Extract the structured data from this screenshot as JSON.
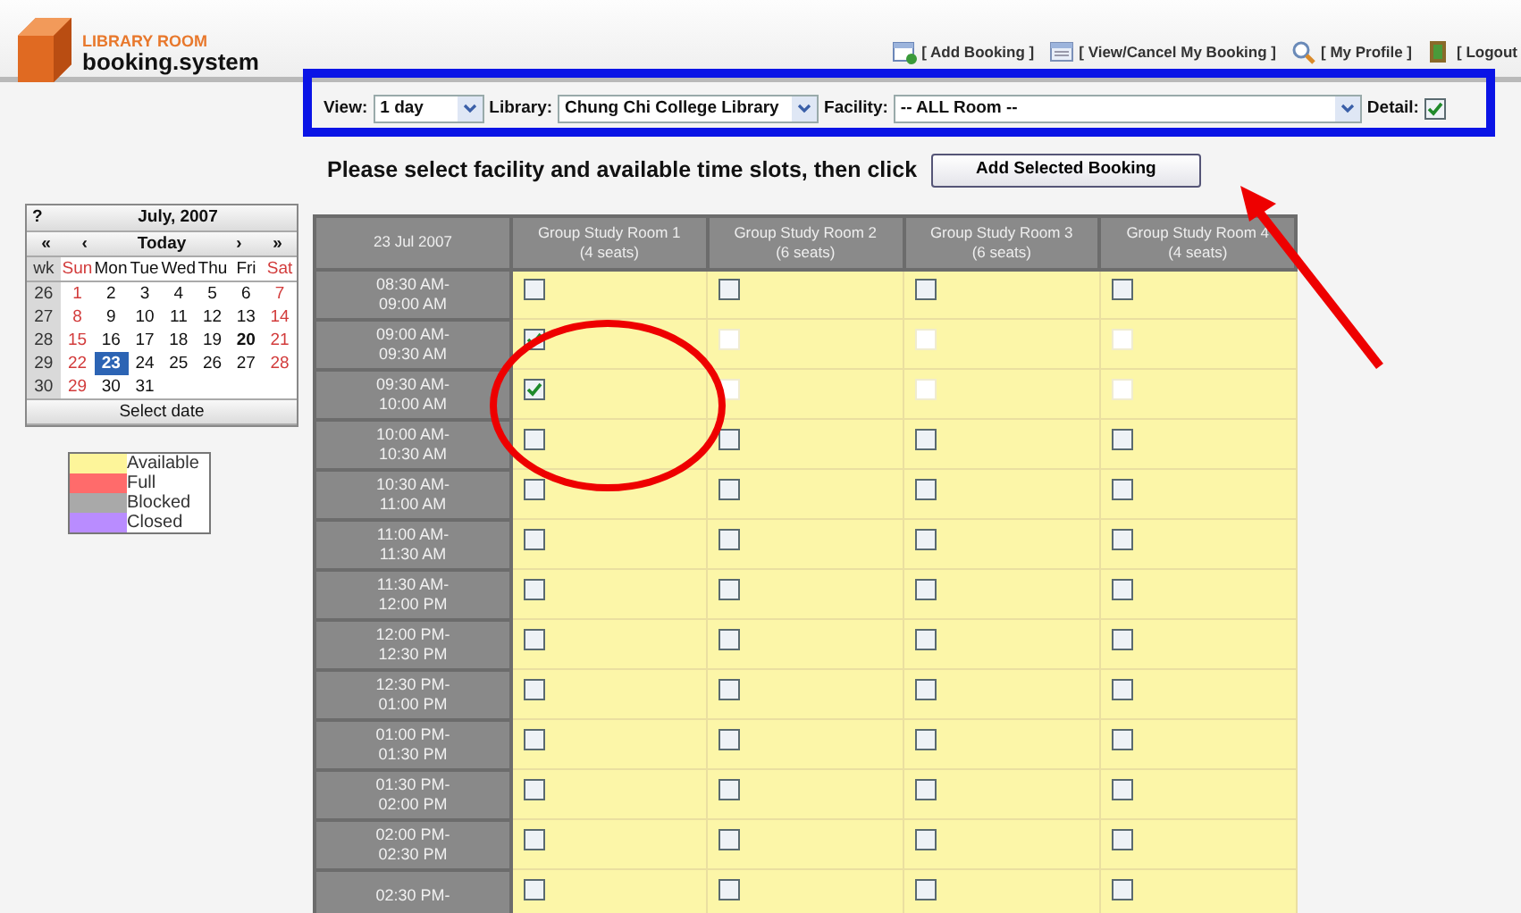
{
  "logo": {
    "line_1": "LIBRARY ROOM",
    "line_2": "booking.system"
  },
  "nav_links": [
    {
      "kind": "add",
      "label": "[ Add Booking ]"
    },
    {
      "kind": "list",
      "label": "[ View/Cancel My Booking ]"
    },
    {
      "kind": "search",
      "label": "[ My Profile ]"
    },
    {
      "kind": "exit",
      "label": "[ Logout"
    }
  ],
  "filters": {
    "view_label": "View:",
    "view_value": "1 day",
    "library_label": "Library:",
    "library_value": "Chung Chi College Library",
    "facility_label": "Facility:",
    "facility_value": "-- ALL Room --",
    "detail_label": "Detail:",
    "detail_checked": true
  },
  "instruction": "Please select facility and available time slots, then click",
  "add_button": "Add Selected Booking",
  "calendar": {
    "help": "?",
    "title": "July, 2007",
    "nav": [
      "«",
      "‹",
      "Today",
      "›",
      "»"
    ],
    "weekdays": [
      {
        "label": "wk",
        "weekend": false
      },
      {
        "label": "Sun",
        "weekend": true
      },
      {
        "label": "Mon",
        "weekend": false
      },
      {
        "label": "Tue",
        "weekend": false
      },
      {
        "label": "Wed",
        "weekend": false
      },
      {
        "label": "Thu",
        "weekend": false
      },
      {
        "label": "Fri",
        "weekend": false
      },
      {
        "label": "Sat",
        "weekend": true
      }
    ],
    "weeks": [
      {
        "week": "26",
        "days": [
          {
            "text": "1",
            "selected": false,
            "today": false
          },
          {
            "text": "2",
            "selected": false,
            "today": false
          },
          {
            "text": "3",
            "selected": false,
            "today": false
          },
          {
            "text": "4",
            "selected": false,
            "today": false
          },
          {
            "text": "5",
            "selected": false,
            "today": false
          },
          {
            "text": "6",
            "selected": false,
            "today": false
          },
          {
            "text": "7",
            "selected": false,
            "today": false
          }
        ]
      },
      {
        "week": "27",
        "days": [
          {
            "text": "8",
            "selected": false,
            "today": false
          },
          {
            "text": "9",
            "selected": false,
            "today": false
          },
          {
            "text": "10",
            "selected": false,
            "today": false
          },
          {
            "text": "11",
            "selected": false,
            "today": false
          },
          {
            "text": "12",
            "selected": false,
            "today": false
          },
          {
            "text": "13",
            "selected": false,
            "today": false
          },
          {
            "text": "14",
            "selected": false,
            "today": false
          }
        ]
      },
      {
        "week": "28",
        "days": [
          {
            "text": "15",
            "selected": false,
            "today": false
          },
          {
            "text": "16",
            "selected": false,
            "today": false
          },
          {
            "text": "17",
            "selected": false,
            "today": false
          },
          {
            "text": "18",
            "selected": false,
            "today": false
          },
          {
            "text": "19",
            "selected": false,
            "today": false
          },
          {
            "text": "20",
            "selected": false,
            "today": true
          },
          {
            "text": "21",
            "selected": false,
            "today": false
          }
        ]
      },
      {
        "week": "29",
        "days": [
          {
            "text": "22",
            "selected": false,
            "today": false
          },
          {
            "text": "23",
            "selected": true,
            "today": false
          },
          {
            "text": "24",
            "selected": false,
            "today": false
          },
          {
            "text": "25",
            "selected": false,
            "today": false
          },
          {
            "text": "26",
            "selected": false,
            "today": false
          },
          {
            "text": "27",
            "selected": false,
            "today": false
          },
          {
            "text": "28",
            "selected": false,
            "today": false
          }
        ]
      },
      {
        "week": "30",
        "days": [
          {
            "text": "29",
            "selected": false,
            "today": false
          },
          {
            "text": "30",
            "selected": false,
            "today": false
          },
          {
            "text": "31",
            "selected": false,
            "today": false
          }
        ]
      }
    ],
    "footer": "Select date"
  },
  "legend": [
    {
      "label": "Available",
      "color": "#fdf59a"
    },
    {
      "label": "Full",
      "color": "#ff6b6b"
    },
    {
      "label": "Blocked",
      "color": "#a9a9a9"
    },
    {
      "label": "Closed",
      "color": "#b98cff"
    }
  ],
  "table": {
    "date": "23 Jul 2007",
    "columns": [
      {
        "name": "Group Study Room 1",
        "seats": "(4 seats)"
      },
      {
        "name": "Group Study Room 2",
        "seats": "(6 seats)"
      },
      {
        "name": "Group Study Room 3",
        "seats": "(6 seats)"
      },
      {
        "name": "Group Study Room 4",
        "seats": "(4 seats)"
      }
    ],
    "rows": [
      {
        "time_1": "08:30 AM-",
        "time_2": "09:00 AM",
        "slots": [
          {
            "checked": false,
            "disabled": false
          },
          {
            "checked": false,
            "disabled": false
          },
          {
            "checked": false,
            "disabled": false
          },
          {
            "checked": false,
            "disabled": false
          }
        ]
      },
      {
        "time_1": "09:00 AM-",
        "time_2": "09:30 AM",
        "slots": [
          {
            "checked": true,
            "disabled": false
          },
          {
            "checked": false,
            "disabled": true
          },
          {
            "checked": false,
            "disabled": true
          },
          {
            "checked": false,
            "disabled": true
          }
        ]
      },
      {
        "time_1": "09:30 AM-",
        "time_2": "10:00 AM",
        "slots": [
          {
            "checked": true,
            "disabled": false
          },
          {
            "checked": false,
            "disabled": true
          },
          {
            "checked": false,
            "disabled": true
          },
          {
            "checked": false,
            "disabled": true
          }
        ]
      },
      {
        "time_1": "10:00 AM-",
        "time_2": "10:30 AM",
        "slots": [
          {
            "checked": false,
            "disabled": false
          },
          {
            "checked": false,
            "disabled": false
          },
          {
            "checked": false,
            "disabled": false
          },
          {
            "checked": false,
            "disabled": false
          }
        ]
      },
      {
        "time_1": "10:30 AM-",
        "time_2": "11:00 AM",
        "slots": [
          {
            "checked": false,
            "disabled": false
          },
          {
            "checked": false,
            "disabled": false
          },
          {
            "checked": false,
            "disabled": false
          },
          {
            "checked": false,
            "disabled": false
          }
        ]
      },
      {
        "time_1": "11:00 AM-",
        "time_2": "11:30 AM",
        "slots": [
          {
            "checked": false,
            "disabled": false
          },
          {
            "checked": false,
            "disabled": false
          },
          {
            "checked": false,
            "disabled": false
          },
          {
            "checked": false,
            "disabled": false
          }
        ]
      },
      {
        "time_1": "11:30 AM-",
        "time_2": "12:00 PM",
        "slots": [
          {
            "checked": false,
            "disabled": false
          },
          {
            "checked": false,
            "disabled": false
          },
          {
            "checked": false,
            "disabled": false
          },
          {
            "checked": false,
            "disabled": false
          }
        ]
      },
      {
        "time_1": "12:00 PM-",
        "time_2": "12:30 PM",
        "slots": [
          {
            "checked": false,
            "disabled": false
          },
          {
            "checked": false,
            "disabled": false
          },
          {
            "checked": false,
            "disabled": false
          },
          {
            "checked": false,
            "disabled": false
          }
        ]
      },
      {
        "time_1": "12:30 PM-",
        "time_2": "01:00 PM",
        "slots": [
          {
            "checked": false,
            "disabled": false
          },
          {
            "checked": false,
            "disabled": false
          },
          {
            "checked": false,
            "disabled": false
          },
          {
            "checked": false,
            "disabled": false
          }
        ]
      },
      {
        "time_1": "01:00 PM-",
        "time_2": "01:30 PM",
        "slots": [
          {
            "checked": false,
            "disabled": false
          },
          {
            "checked": false,
            "disabled": false
          },
          {
            "checked": false,
            "disabled": false
          },
          {
            "checked": false,
            "disabled": false
          }
        ]
      },
      {
        "time_1": "01:30 PM-",
        "time_2": "02:00 PM",
        "slots": [
          {
            "checked": false,
            "disabled": false
          },
          {
            "checked": false,
            "disabled": false
          },
          {
            "checked": false,
            "disabled": false
          },
          {
            "checked": false,
            "disabled": false
          }
        ]
      },
      {
        "time_1": "02:00 PM-",
        "time_2": "02:30 PM",
        "slots": [
          {
            "checked": false,
            "disabled": false
          },
          {
            "checked": false,
            "disabled": false
          },
          {
            "checked": false,
            "disabled": false
          },
          {
            "checked": false,
            "disabled": false
          }
        ]
      },
      {
        "time_1": "02:30 PM-",
        "slots": [
          {
            "checked": false,
            "disabled": false
          },
          {
            "checked": false,
            "disabled": false
          },
          {
            "checked": false,
            "disabled": false
          },
          {
            "checked": false,
            "disabled": false
          }
        ]
      }
    ]
  }
}
